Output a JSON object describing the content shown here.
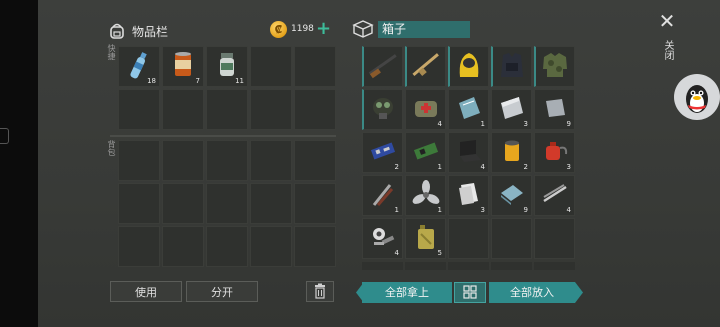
{
  "inventory": {
    "title": "物品栏",
    "coins": "1198",
    "quick_label": "快捷",
    "bag_label": "背包",
    "quick_slots": [
      {
        "icon": "water-bottle-icon",
        "count": "18"
      },
      {
        "icon": "canned-food-icon",
        "count": "7"
      },
      {
        "icon": "pill-jar-icon",
        "count": "11"
      },
      {
        "icon": "",
        "count": ""
      },
      {
        "icon": "",
        "count": ""
      },
      {
        "icon": "",
        "count": ""
      },
      {
        "icon": "",
        "count": ""
      },
      {
        "icon": "",
        "count": ""
      },
      {
        "icon": "",
        "count": ""
      },
      {
        "icon": "",
        "count": ""
      }
    ],
    "use_button": "使用",
    "split_button": "分开"
  },
  "box": {
    "title": "箱子",
    "close_label": "关闭",
    "take_all_button": "全部拿上",
    "put_all_button": "全部放入",
    "items": [
      {
        "icon": "shotgun-icon",
        "count": ""
      },
      {
        "icon": "rifle-icon",
        "count": ""
      },
      {
        "icon": "hazmat-hood-icon",
        "count": ""
      },
      {
        "icon": "tactical-vest-icon",
        "count": ""
      },
      {
        "icon": "camo-jacket-icon",
        "count": ""
      },
      {
        "icon": "gas-mask-icon",
        "count": ""
      },
      {
        "icon": "medkit-bag-icon",
        "count": "4"
      },
      {
        "icon": "glass-sheet-icon",
        "count": "1"
      },
      {
        "icon": "steel-plate-icon",
        "count": "3"
      },
      {
        "icon": "metal-plate-icon",
        "count": "9"
      },
      {
        "icon": "circuit-board-icon",
        "count": "2"
      },
      {
        "icon": "green-board-icon",
        "count": "1"
      },
      {
        "icon": "laptop-icon",
        "count": "4"
      },
      {
        "icon": "oil-filter-icon",
        "count": "2"
      },
      {
        "icon": "red-canister-icon",
        "count": "3"
      },
      {
        "icon": "tools-icon",
        "count": "1"
      },
      {
        "icon": "propeller-icon",
        "count": "1"
      },
      {
        "icon": "paper-icon",
        "count": "3"
      },
      {
        "icon": "fabric-icon",
        "count": "9"
      },
      {
        "icon": "metal-rods-icon",
        "count": "4"
      },
      {
        "icon": "parts-pile-icon",
        "count": "4"
      },
      {
        "icon": "jerrycan-icon",
        "count": "5"
      },
      {
        "icon": "",
        "count": ""
      },
      {
        "icon": "",
        "count": ""
      },
      {
        "icon": "",
        "count": ""
      }
    ]
  }
}
